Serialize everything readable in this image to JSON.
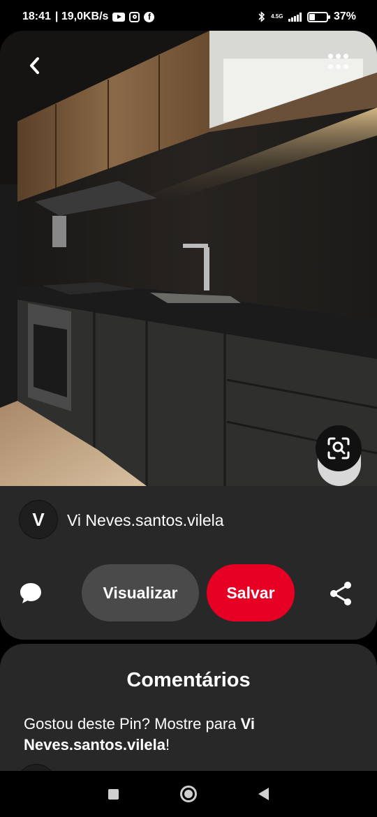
{
  "status_bar": {
    "time": "18:41",
    "net_speed": "| 19,0KB/s",
    "notification_icons": [
      "youtube-icon",
      "instagram-icon",
      "facebook-icon"
    ],
    "network_gen": "4.5G",
    "battery_percent": 37,
    "battery_label": "37%"
  },
  "pin": {
    "image_description_icon": "kitchen-photo",
    "creator_initial": "V",
    "creator_name": "Vi Neves.santos.vilela",
    "buttons": {
      "visualize": "Visualizar",
      "save": "Salvar"
    },
    "colors": {
      "save": "#e60023",
      "card_background": "#282828"
    }
  },
  "comments": {
    "title": "Comentários",
    "prompt_prefix": "Gostou deste Pin? Mostre para ",
    "prompt_name": "Vi Neves.santos.vilela",
    "prompt_suffix": "!"
  },
  "nav_bar": {
    "icons": [
      "recents-square-icon",
      "home-circle-icon",
      "back-triangle-icon"
    ]
  }
}
